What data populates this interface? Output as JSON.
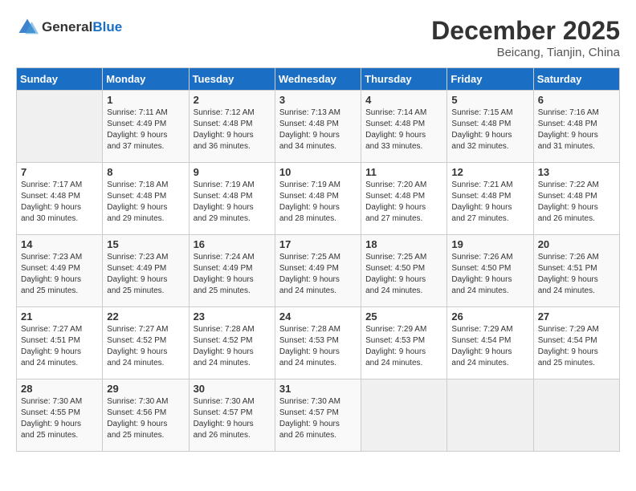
{
  "logo": {
    "general": "General",
    "blue": "Blue"
  },
  "header": {
    "month": "December 2025",
    "location": "Beicang, Tianjin, China"
  },
  "weekdays": [
    "Sunday",
    "Monday",
    "Tuesday",
    "Wednesday",
    "Thursday",
    "Friday",
    "Saturday"
  ],
  "weeks": [
    [
      {
        "day": "",
        "info": ""
      },
      {
        "day": "1",
        "info": "Sunrise: 7:11 AM\nSunset: 4:49 PM\nDaylight: 9 hours\nand 37 minutes."
      },
      {
        "day": "2",
        "info": "Sunrise: 7:12 AM\nSunset: 4:48 PM\nDaylight: 9 hours\nand 36 minutes."
      },
      {
        "day": "3",
        "info": "Sunrise: 7:13 AM\nSunset: 4:48 PM\nDaylight: 9 hours\nand 34 minutes."
      },
      {
        "day": "4",
        "info": "Sunrise: 7:14 AM\nSunset: 4:48 PM\nDaylight: 9 hours\nand 33 minutes."
      },
      {
        "day": "5",
        "info": "Sunrise: 7:15 AM\nSunset: 4:48 PM\nDaylight: 9 hours\nand 32 minutes."
      },
      {
        "day": "6",
        "info": "Sunrise: 7:16 AM\nSunset: 4:48 PM\nDaylight: 9 hours\nand 31 minutes."
      }
    ],
    [
      {
        "day": "7",
        "info": "Sunrise: 7:17 AM\nSunset: 4:48 PM\nDaylight: 9 hours\nand 30 minutes."
      },
      {
        "day": "8",
        "info": "Sunrise: 7:18 AM\nSunset: 4:48 PM\nDaylight: 9 hours\nand 29 minutes."
      },
      {
        "day": "9",
        "info": "Sunrise: 7:19 AM\nSunset: 4:48 PM\nDaylight: 9 hours\nand 29 minutes."
      },
      {
        "day": "10",
        "info": "Sunrise: 7:19 AM\nSunset: 4:48 PM\nDaylight: 9 hours\nand 28 minutes."
      },
      {
        "day": "11",
        "info": "Sunrise: 7:20 AM\nSunset: 4:48 PM\nDaylight: 9 hours\nand 27 minutes."
      },
      {
        "day": "12",
        "info": "Sunrise: 7:21 AM\nSunset: 4:48 PM\nDaylight: 9 hours\nand 27 minutes."
      },
      {
        "day": "13",
        "info": "Sunrise: 7:22 AM\nSunset: 4:48 PM\nDaylight: 9 hours\nand 26 minutes."
      }
    ],
    [
      {
        "day": "14",
        "info": "Sunrise: 7:23 AM\nSunset: 4:49 PM\nDaylight: 9 hours\nand 25 minutes."
      },
      {
        "day": "15",
        "info": "Sunrise: 7:23 AM\nSunset: 4:49 PM\nDaylight: 9 hours\nand 25 minutes."
      },
      {
        "day": "16",
        "info": "Sunrise: 7:24 AM\nSunset: 4:49 PM\nDaylight: 9 hours\nand 25 minutes."
      },
      {
        "day": "17",
        "info": "Sunrise: 7:25 AM\nSunset: 4:49 PM\nDaylight: 9 hours\nand 24 minutes."
      },
      {
        "day": "18",
        "info": "Sunrise: 7:25 AM\nSunset: 4:50 PM\nDaylight: 9 hours\nand 24 minutes."
      },
      {
        "day": "19",
        "info": "Sunrise: 7:26 AM\nSunset: 4:50 PM\nDaylight: 9 hours\nand 24 minutes."
      },
      {
        "day": "20",
        "info": "Sunrise: 7:26 AM\nSunset: 4:51 PM\nDaylight: 9 hours\nand 24 minutes."
      }
    ],
    [
      {
        "day": "21",
        "info": "Sunrise: 7:27 AM\nSunset: 4:51 PM\nDaylight: 9 hours\nand 24 minutes."
      },
      {
        "day": "22",
        "info": "Sunrise: 7:27 AM\nSunset: 4:52 PM\nDaylight: 9 hours\nand 24 minutes."
      },
      {
        "day": "23",
        "info": "Sunrise: 7:28 AM\nSunset: 4:52 PM\nDaylight: 9 hours\nand 24 minutes."
      },
      {
        "day": "24",
        "info": "Sunrise: 7:28 AM\nSunset: 4:53 PM\nDaylight: 9 hours\nand 24 minutes."
      },
      {
        "day": "25",
        "info": "Sunrise: 7:29 AM\nSunset: 4:53 PM\nDaylight: 9 hours\nand 24 minutes."
      },
      {
        "day": "26",
        "info": "Sunrise: 7:29 AM\nSunset: 4:54 PM\nDaylight: 9 hours\nand 24 minutes."
      },
      {
        "day": "27",
        "info": "Sunrise: 7:29 AM\nSunset: 4:54 PM\nDaylight: 9 hours\nand 25 minutes."
      }
    ],
    [
      {
        "day": "28",
        "info": "Sunrise: 7:30 AM\nSunset: 4:55 PM\nDaylight: 9 hours\nand 25 minutes."
      },
      {
        "day": "29",
        "info": "Sunrise: 7:30 AM\nSunset: 4:56 PM\nDaylight: 9 hours\nand 25 minutes."
      },
      {
        "day": "30",
        "info": "Sunrise: 7:30 AM\nSunset: 4:57 PM\nDaylight: 9 hours\nand 26 minutes."
      },
      {
        "day": "31",
        "info": "Sunrise: 7:30 AM\nSunset: 4:57 PM\nDaylight: 9 hours\nand 26 minutes."
      },
      {
        "day": "",
        "info": ""
      },
      {
        "day": "",
        "info": ""
      },
      {
        "day": "",
        "info": ""
      }
    ]
  ]
}
